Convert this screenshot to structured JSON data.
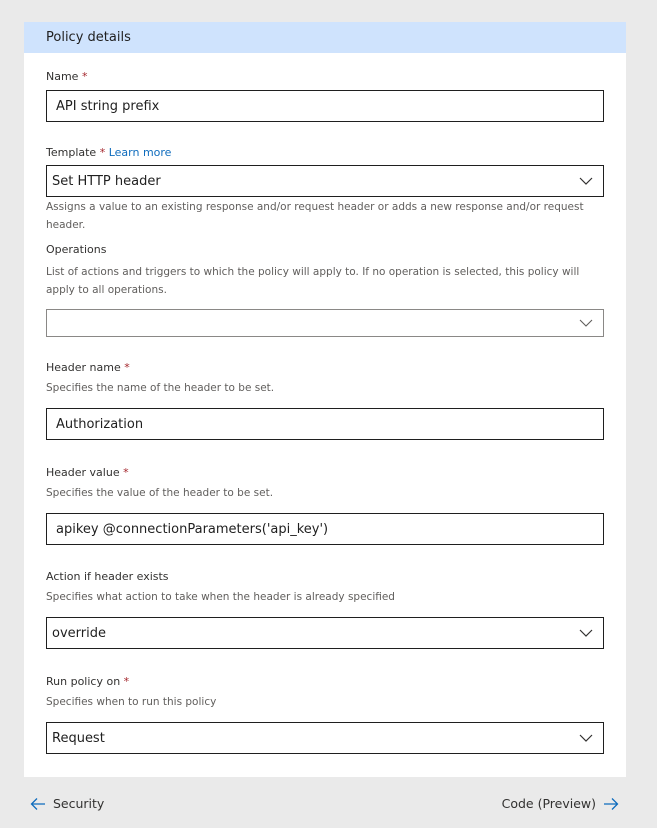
{
  "panel": {
    "title": "Policy details"
  },
  "fields": {
    "name": {
      "label": "Name",
      "required": "*",
      "value": "API string prefix"
    },
    "template": {
      "label": "Template",
      "required": "*",
      "learn_more": "Learn more",
      "value": "Set HTTP header",
      "description": "Assigns a value to an existing response and/or request header or adds a new response and/or request header."
    },
    "operations": {
      "label": "Operations",
      "description": "List of actions and triggers to which the policy will apply to. If no operation is selected, this policy will apply to all operations.",
      "value": ""
    },
    "header_name": {
      "label": "Header name",
      "required": "*",
      "description": "Specifies the name of the header to be set.",
      "value": "Authorization"
    },
    "header_value": {
      "label": "Header value",
      "required": "*",
      "description": "Specifies the value of the header to be set.",
      "value": "apikey @connectionParameters('api_key')"
    },
    "action_if_exists": {
      "label": "Action if header exists",
      "description": "Specifies what action to take when the header is already specified",
      "value": "override"
    },
    "run_policy_on": {
      "label": "Run policy on",
      "required": "*",
      "description": "Specifies when to run this policy",
      "value": "Request"
    }
  },
  "footer": {
    "back_label": "Security",
    "next_label": "Code (Preview)"
  },
  "colors": {
    "header_bg": "#cfe3fd",
    "required": "#a4262c",
    "link": "#0f6cbd",
    "arrow": "#0f6cbd"
  },
  "icons": {
    "dropdown": "chevron-down-icon",
    "back": "arrow-left-icon",
    "next": "arrow-right-icon"
  }
}
